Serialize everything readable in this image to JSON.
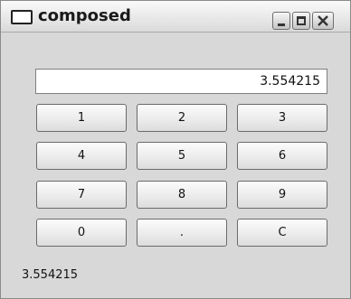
{
  "window": {
    "title": "composed",
    "controls": [
      "minimize-icon",
      "maximize-icon",
      "close-icon"
    ]
  },
  "display": {
    "value": "3.554215"
  },
  "keypad": {
    "keys": [
      "1",
      "2",
      "3",
      "4",
      "5",
      "6",
      "7",
      "8",
      "9",
      "0",
      ".",
      "C"
    ]
  },
  "status": {
    "text": "3.554215"
  }
}
